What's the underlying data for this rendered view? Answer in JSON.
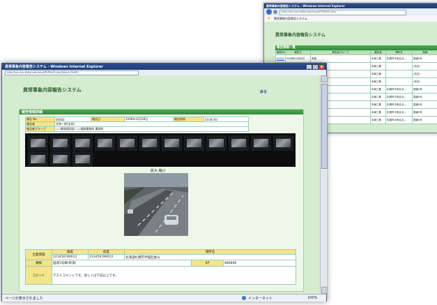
{
  "back_window": {
    "title": "異常事象内容報告システム - Windows Internet Explorer",
    "address": "http://xxx.xxx-ehttp.com/xxxx/PUP0A01.php",
    "tab": "異常事象内容報告システム",
    "app_title": "異常事象内容報告システム",
    "section": "報告情報一覧",
    "columns": [
      "報告No",
      "報告日",
      "報告者グループ",
      "報告者",
      "場所名",
      "路線"
    ],
    "rows": [
      [
        "00001",
        "2008年10月6日",
        "本局",
        "本局工務",
        "札幌市中央区北...",
        "国道5号"
      ],
      [
        "",
        "",
        "",
        "本局工務",
        "",
        "(未定)"
      ],
      [
        "",
        "",
        "",
        "本局工務",
        "",
        "(未定)"
      ],
      [
        "",
        "",
        "",
        "本局工務",
        "",
        "(未定)"
      ],
      [
        "",
        "",
        "",
        "本局工務",
        "札幌市中央区北...",
        "国道5号"
      ],
      [
        "",
        "",
        "",
        "本局工務",
        "札幌市中央区北...",
        "国道5号"
      ],
      [
        "",
        "",
        "",
        "本局工務",
        "札幌市中央区北...",
        "国道5号"
      ],
      [
        "",
        "",
        "",
        "本局工務",
        "札幌市中央区北...",
        "国道5号"
      ],
      [
        "",
        "",
        "",
        "本局工務",
        "札幌市中央区北...",
        "国道5号"
      ]
    ]
  },
  "front_window": {
    "title": "異常事象内容報告システム - Windows Internet Explorer",
    "address": "http://xxx.xxx-ehttp.com/xxxx/PUP0A01.php?bhno=00002",
    "app_title": "異常事象内容報告システム",
    "print_link": "戻る",
    "section": "報告情報詳細",
    "details": {
      "no_label": "報告 No",
      "no_value": "00002",
      "date_label": "報告日",
      "date_value": "2008年10月28日",
      "time_label": "報告時刻",
      "time_value": "10:00:00",
      "reporter_label": "報告者",
      "reporter_value": "北海一郎(支局)",
      "group_label": "報告者グループ",
      "group_value": "○○開発建設部 ○○道路事務所 事務所"
    },
    "photo_caption": "拡大 縮小",
    "location": {
      "label": "位置情報",
      "lat_header": "緯度",
      "lon_header": "経度",
      "place_header": "場所名",
      "lat_value": "123456789012",
      "lon_value": "223456789012",
      "place_value": "北海道札幌市手稲区金山"
    },
    "route": {
      "label": "路線",
      "value": "国道5号線(新道)",
      "kp_label": "KP",
      "kp_value": "888888"
    },
    "comment": {
      "label": "コメント",
      "value": "テストコメントです。詳しくは下記以上です。"
    },
    "status_text": "ページが表示されました",
    "zone": "インターネット",
    "zoom": "100%"
  },
  "colors": {
    "title_bar": "#1c3a73",
    "green_bg": "#d6ecd0",
    "section_green": "#2e8a3b",
    "header_yellow": "#f3e58a"
  }
}
